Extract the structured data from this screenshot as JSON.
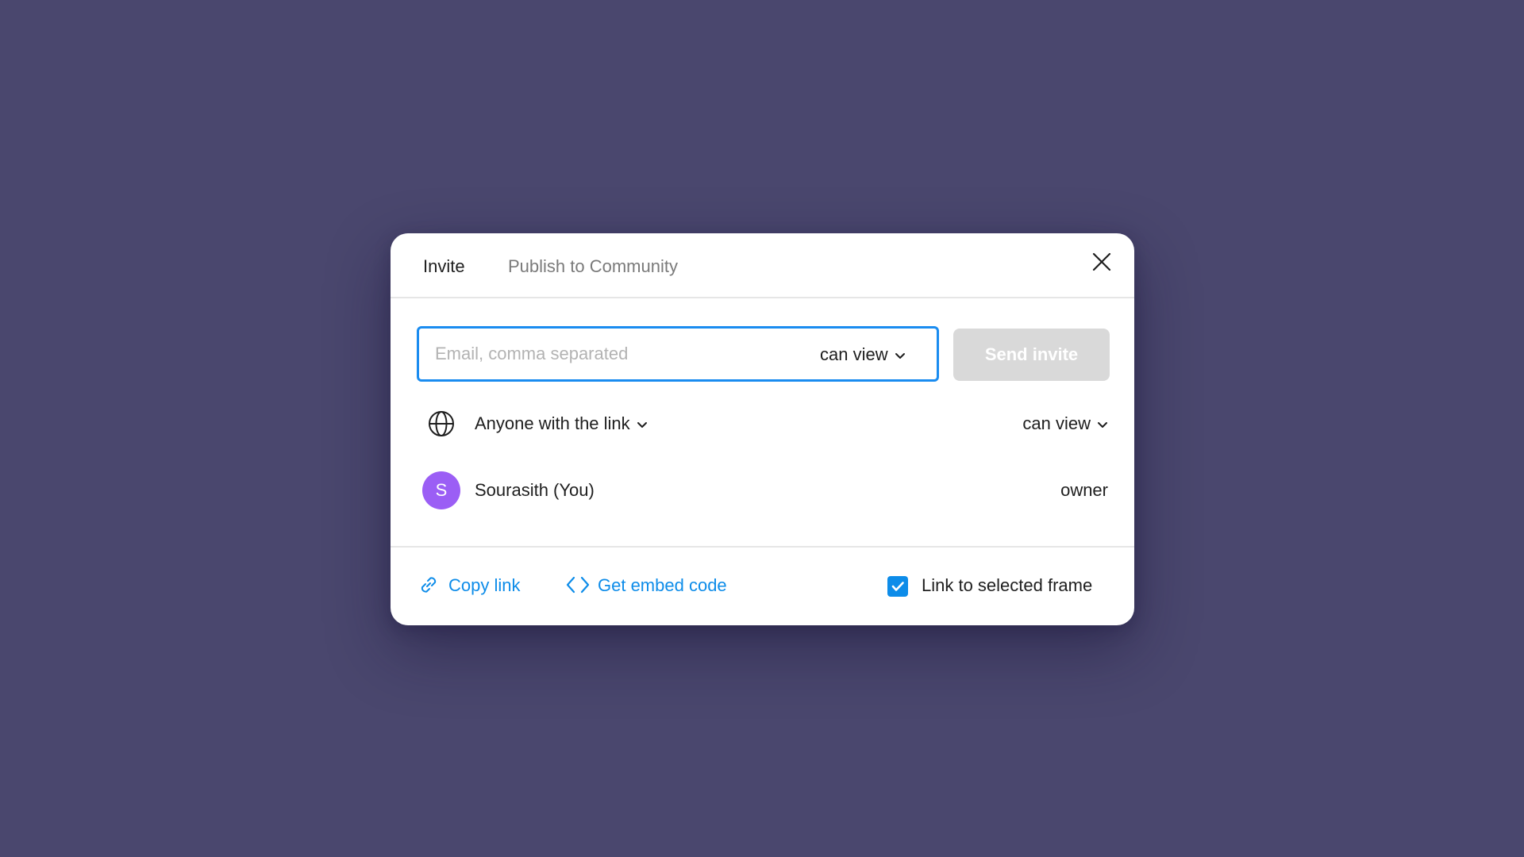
{
  "tabs": {
    "invite": "Invite",
    "publish": "Publish to Community"
  },
  "invite_form": {
    "email_placeholder": "Email, comma separated",
    "email_value": "",
    "permission": "can view",
    "send_label": "Send invite"
  },
  "link_access": {
    "scope": "Anyone with the link",
    "permission": "can view"
  },
  "members": [
    {
      "initial": "S",
      "name": "Sourasith (You)",
      "role": "owner",
      "avatar_color": "#9b5ef5"
    }
  ],
  "footer": {
    "copy_link": "Copy link",
    "embed_code": "Get embed code",
    "link_to_frame_label": "Link to selected frame",
    "link_to_frame_checked": true
  },
  "colors": {
    "accent": "#0d8ce9",
    "focus_border": "#1a8cf0",
    "backdrop": "#4a476e",
    "disabled_button": "#d9d9d9"
  },
  "icons": [
    "close-icon",
    "chevron-down-icon",
    "globe-icon",
    "link-icon",
    "code-icon",
    "check-icon"
  ]
}
